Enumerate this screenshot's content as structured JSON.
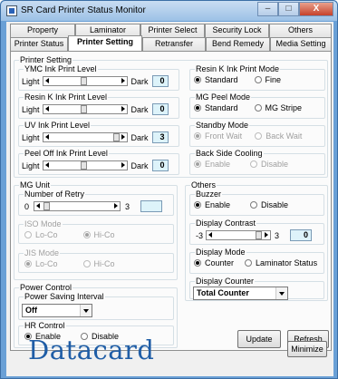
{
  "window": {
    "title": "SR Card Printer Status Monitor",
    "min": "–",
    "max": "□",
    "close": "X"
  },
  "tabs_row1": [
    "Property",
    "Laminator",
    "Printer Select",
    "Security Lock",
    "Others"
  ],
  "tabs_row2": [
    "Printer Status",
    "Printer Setting",
    "Retransfer",
    "Bend Remedy",
    "Media Setting"
  ],
  "printer_setting": {
    "title": "Printer Setting",
    "ymc": {
      "label": "YMC Ink Print Level",
      "light": "Light",
      "dark": "Dark",
      "value": "0"
    },
    "resin": {
      "label": "Resin K Ink Print Level",
      "light": "Light",
      "dark": "Dark",
      "value": "0"
    },
    "uv": {
      "label": "UV Ink Print Level",
      "light": "Light",
      "dark": "Dark",
      "value": "3"
    },
    "peel": {
      "label": "Peel Off Ink Print Level",
      "light": "Light",
      "dark": "Dark",
      "value": "0"
    },
    "resin_mode": {
      "label": "Resin K Ink Print Mode",
      "opt1": "Standard",
      "opt2": "Fine"
    },
    "mg_peel": {
      "label": "MG Peel Mode",
      "opt1": "Standard",
      "opt2": "MG Stripe"
    },
    "standby": {
      "label": "Standby Mode",
      "opt1": "Front Wait",
      "opt2": "Back Wait"
    },
    "backside": {
      "label": "Back Side Cooling",
      "opt1": "Enable",
      "opt2": "Disable"
    }
  },
  "mg_unit": {
    "title": "MG Unit",
    "retry": {
      "label": "Number of Retry",
      "min": "0",
      "max": "3",
      "value": ""
    },
    "iso": {
      "label": "ISO Mode",
      "opt1": "Lo-Co",
      "opt2": "Hi-Co"
    },
    "jis": {
      "label": "JIS Mode",
      "opt1": "Lo-Co",
      "opt2": "Hi-Co"
    }
  },
  "others": {
    "title": "Others",
    "buzzer": {
      "label": "Buzzer",
      "opt1": "Enable",
      "opt2": "Disable"
    },
    "contrast": {
      "label": "Display Contrast",
      "min": "-3",
      "max": "3",
      "value": "0"
    },
    "display_mode": {
      "label": "Display Mode",
      "opt1": "Counter",
      "opt2": "Laminator Status"
    },
    "display_counter": {
      "label": "Display Counter",
      "value": "Total Counter"
    }
  },
  "power": {
    "title": "Power Control",
    "saving": {
      "label": "Power Saving Interval",
      "value": "Off"
    },
    "hr": {
      "label": "HR Control",
      "opt1": "Enable",
      "opt2": "Disable"
    }
  },
  "buttons": {
    "update": "Update",
    "refresh": "Refresh",
    "minimize": "Minimize"
  },
  "brand": {
    "logo": "Datacard",
    "color": "#1f5da6"
  },
  "colors": {
    "value_box": "#ddf3fa",
    "window_frame": "#6aa0d6"
  }
}
